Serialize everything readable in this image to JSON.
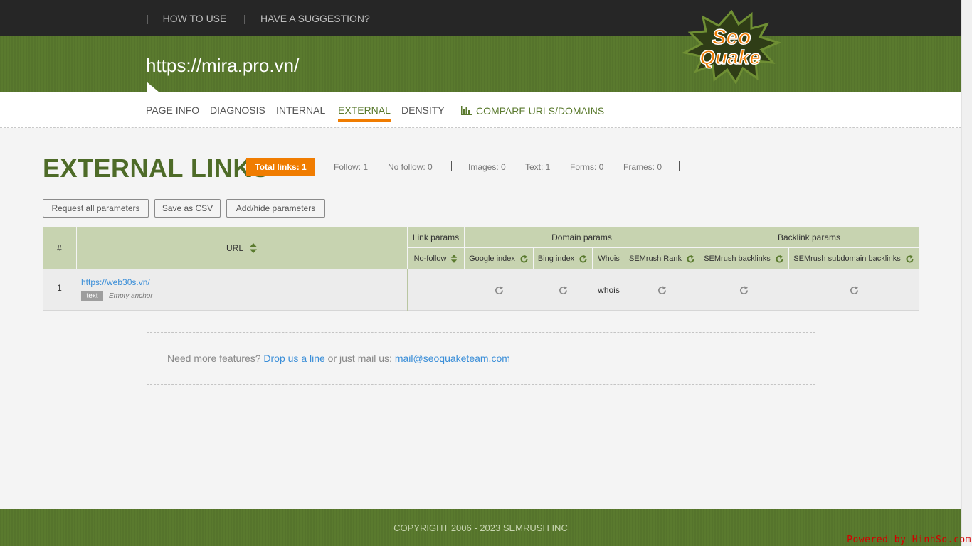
{
  "topnav": {
    "separator": "|",
    "how_to_use": "HOW TO USE",
    "suggestion": "HAVE A SUGGESTION?"
  },
  "site": {
    "url": "https://mira.pro.vn/"
  },
  "logo": {
    "line1": "Seo",
    "line2": "Quake"
  },
  "tabs": [
    {
      "label": "PAGE INFO"
    },
    {
      "label": "DIAGNOSIS"
    },
    {
      "label": "INTERNAL"
    },
    {
      "label": "EXTERNAL",
      "active": true
    },
    {
      "label": "DENSITY"
    },
    {
      "label": "COMPARE URLS/DOMAINS",
      "icon": "bar-chart-icon"
    }
  ],
  "page": {
    "title": "EXTERNAL LINKS",
    "total_label": "Total links:  1",
    "stats": {
      "follow": "Follow:  1",
      "nofollow": "No follow:  0",
      "images": "Images:  0",
      "text": "Text:  1",
      "forms": "Forms:  0",
      "frames": "Frames:  0"
    }
  },
  "buttons": {
    "request": "Request all parameters",
    "csv": "Save as CSV",
    "addhide": "Add/hide parameters"
  },
  "table": {
    "headers": {
      "num": "#",
      "url": "URL",
      "link_params": "Link params",
      "domain_params": "Domain params",
      "backlink_params": "Backlink params",
      "nofollow": "No-follow",
      "google_index": "Google index",
      "bing_index": "Bing index",
      "whois": "Whois",
      "semrush_rank": "SEMrush Rank",
      "semrush_backlinks": "SEMrush backlinks",
      "semrush_subdomain_backlinks": "SEMrush subdomain backlinks"
    },
    "rows": [
      {
        "num": "1",
        "url": "https://web30s.vn/",
        "tag": "text",
        "anchor": "Empty anchor",
        "whois": "whois"
      }
    ]
  },
  "feature": {
    "prefix": "Need more features? ",
    "link": "Drop us a line",
    "middle": " or just mail us: ",
    "email": "mail@seoquaketeam.com"
  },
  "footer": {
    "copyright": "COPYRIGHT 2006 - 2023 SEMRUSH INC"
  },
  "watermark": "Powered by HinhSo.com",
  "colors": {
    "green": "#5a7a2e",
    "orange": "#f07c00",
    "link": "#3a8ed8",
    "header_bg": "#c7d3b0"
  }
}
